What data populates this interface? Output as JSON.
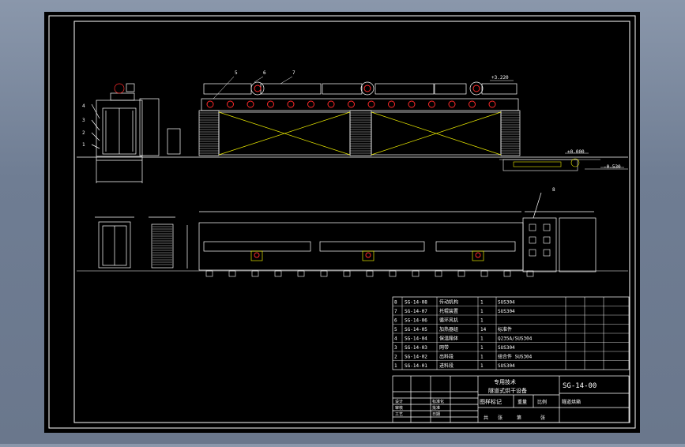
{
  "colors": {
    "canvas": "#000000",
    "line": "#ffffff",
    "accent_red": "#ff2a2a",
    "accent_yellow": "#e6e600",
    "window_bg": "#7f8ca2"
  },
  "front_view": {
    "elevation_top": "+3.220",
    "elevation_base": "±0.000",
    "elevation_pit": "-0.530",
    "callouts": [
      "5",
      "6",
      "7"
    ],
    "side_callouts": [
      "4",
      "3",
      "2",
      "1"
    ]
  },
  "plan_view": {
    "callout": "8"
  },
  "parts_table": {
    "rows": [
      {
        "no": "8",
        "code": "SG-14-08",
        "name": "传动机构",
        "qty": "1",
        "material": "SUS304"
      },
      {
        "no": "7",
        "code": "SG-14-07",
        "name": "托辊装置",
        "qty": "1",
        "material": "SUS304"
      },
      {
        "no": "6",
        "code": "SG-14-06",
        "name": "循环风机",
        "qty": "1",
        "material": ""
      },
      {
        "no": "5",
        "code": "SG-14-05",
        "name": "加热器组",
        "qty": "14",
        "material": "标准件"
      },
      {
        "no": "4",
        "code": "SG-14-04",
        "name": "保温箱体",
        "qty": "1",
        "material": "Q235A/SUS304"
      },
      {
        "no": "3",
        "code": "SG-14-03",
        "name": "网带",
        "qty": "1",
        "material": "SUS304"
      },
      {
        "no": "2",
        "code": "SG-14-02",
        "name": "出料段",
        "qty": "1",
        "material": "组合件 SUS304"
      },
      {
        "no": "1",
        "code": "SG-14-01",
        "name": "进料段",
        "qty": "1",
        "material": "SUS304"
      }
    ]
  },
  "title_block": {
    "drawing_no": "SG-14-00",
    "title_line1": "专用技术",
    "title_line2": "隧道式烘干设备",
    "stage_label": "图样标记",
    "weight_label": "重量",
    "scale_label": "比例",
    "company": "隧道烘箱",
    "sheet_label": "共",
    "sheet_of": "张",
    "sheet_no_label": "第",
    "page_label": "张",
    "rows_left": [
      "设计",
      "审核",
      "工艺"
    ],
    "rows_mid": [
      "标准化",
      "批准",
      "日期"
    ]
  }
}
